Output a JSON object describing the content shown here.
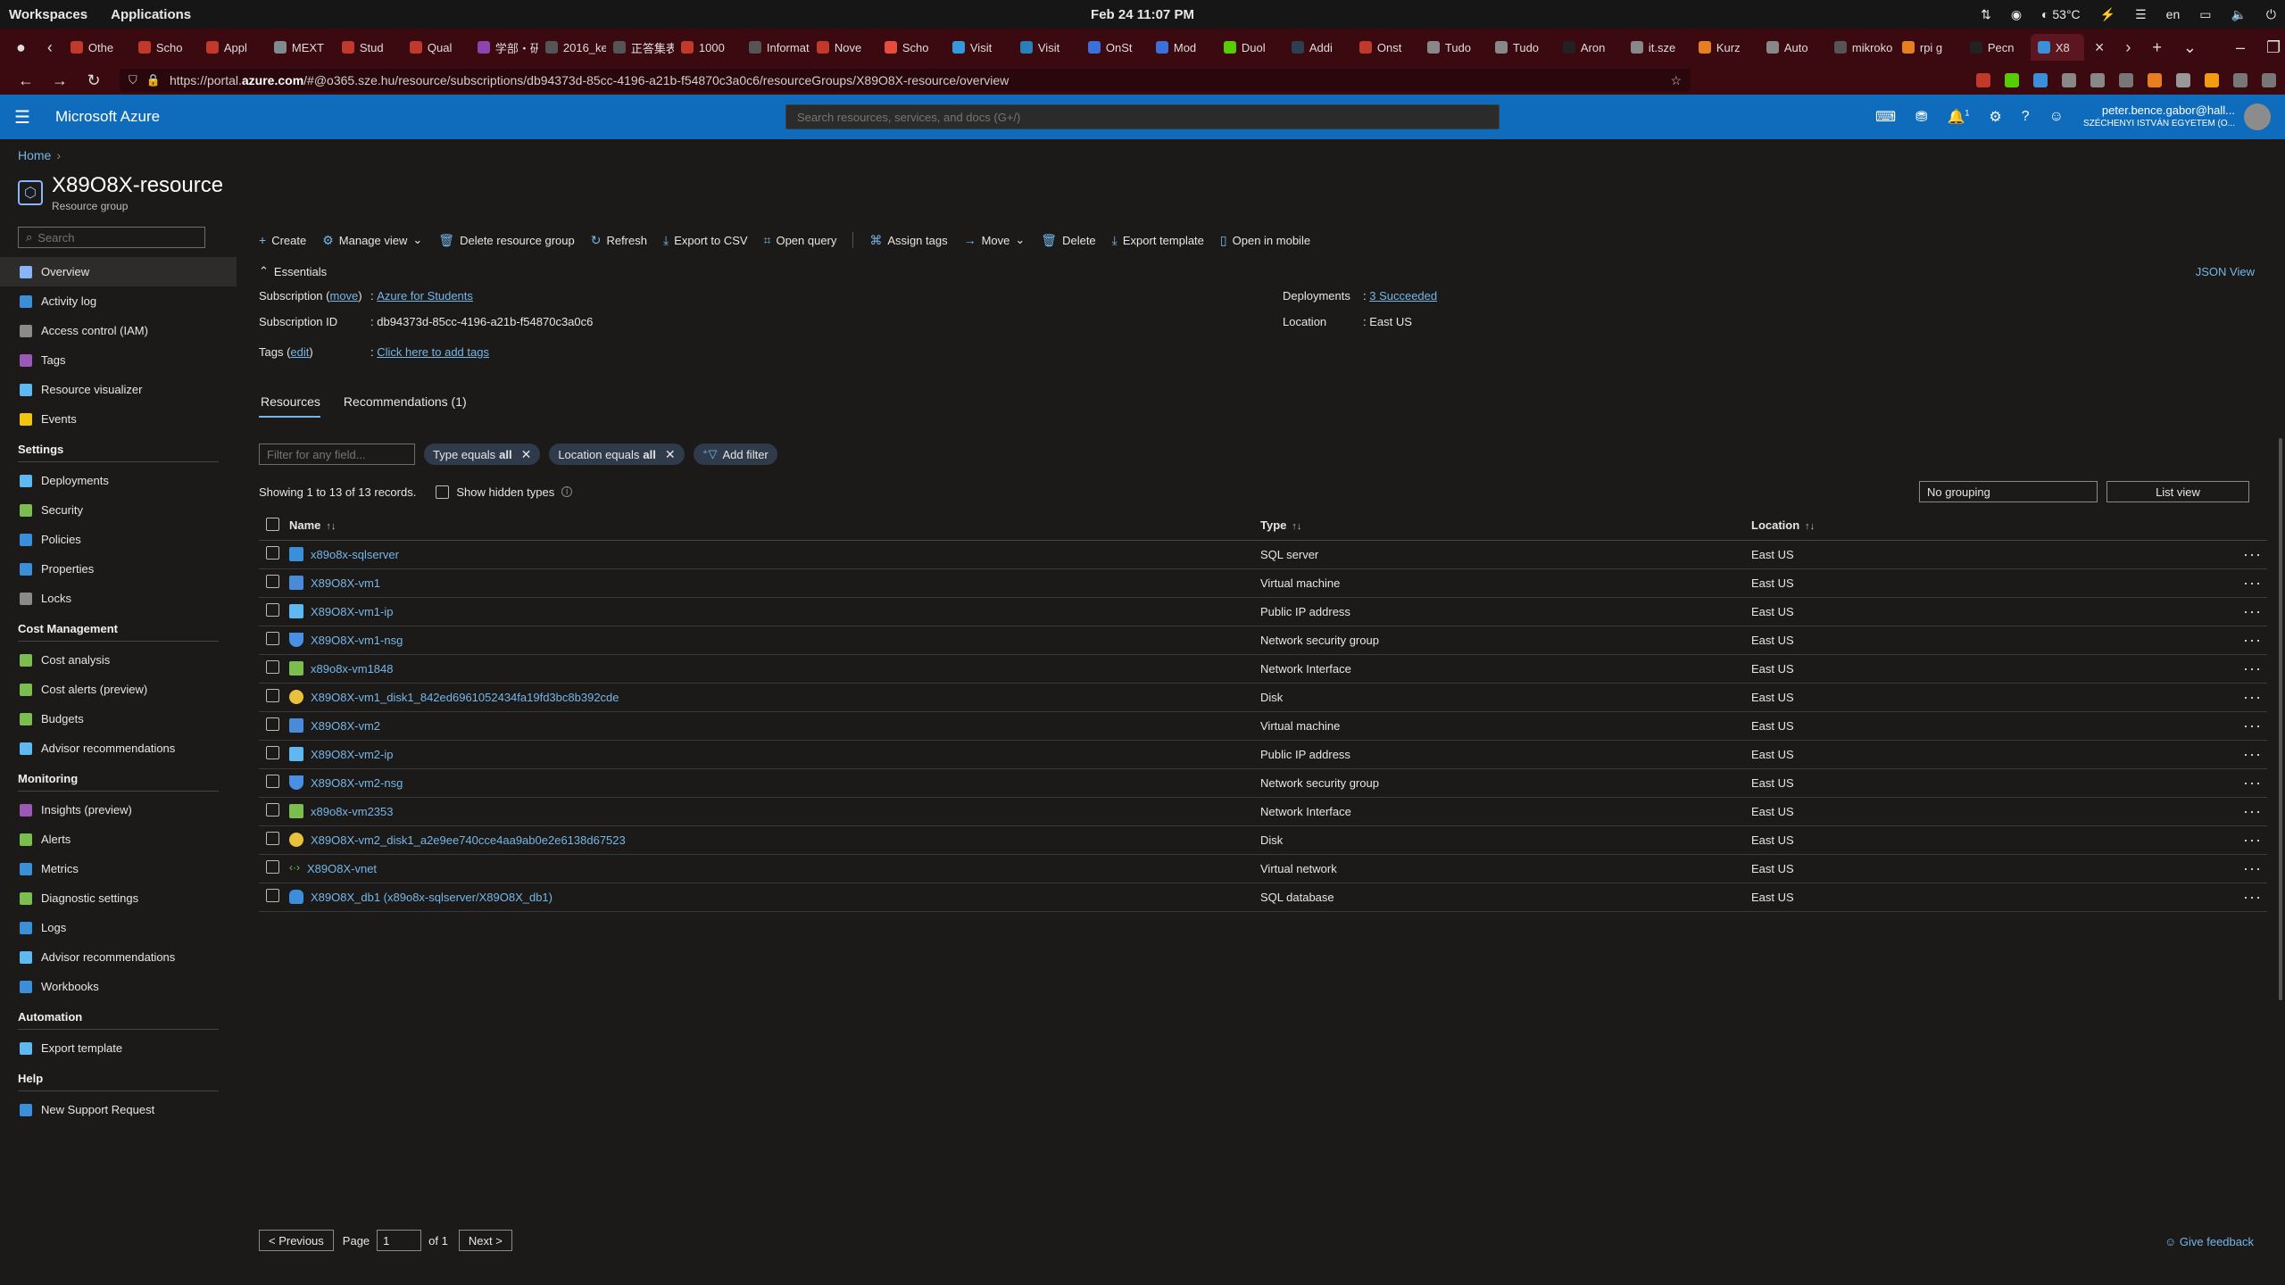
{
  "os": {
    "workspaces": "Workspaces",
    "applications": "Applications",
    "clock": "Feb 24  11:07 PM",
    "temp": "53°C",
    "lang": "en"
  },
  "browser": {
    "tabs": [
      {
        "label": "Othe",
        "color": "#c0392b"
      },
      {
        "label": "Scho",
        "color": "#c0392b"
      },
      {
        "label": "Appl",
        "color": "#c0392b"
      },
      {
        "label": "MEXT",
        "color": "#7f8c8d"
      },
      {
        "label": "Stud",
        "color": "#c0392b"
      },
      {
        "label": "Qual",
        "color": "#c0392b"
      },
      {
        "label": "学部・研",
        "color": "#8e44ad"
      },
      {
        "label": "2016_ke",
        "color": "#555555"
      },
      {
        "label": "正答集表",
        "color": "#555555"
      },
      {
        "label": "1000",
        "color": "#c0392b"
      },
      {
        "label": "Informat",
        "color": "#555555"
      },
      {
        "label": "Nove",
        "color": "#c0392b"
      },
      {
        "label": "Scho",
        "color": "#e74c3c"
      },
      {
        "label": "Visit",
        "color": "#3498db"
      },
      {
        "label": "Visit",
        "color": "#2980b9"
      },
      {
        "label": "OnSt",
        "color": "#3b6fd9"
      },
      {
        "label": "Mod",
        "color": "#3b6fd9"
      },
      {
        "label": "Duol",
        "color": "#58cc02"
      },
      {
        "label": "Addi",
        "color": "#2c3e50"
      },
      {
        "label": "Onst",
        "color": "#c0392b"
      },
      {
        "label": "Tudo",
        "color": "#888888"
      },
      {
        "label": "Tudo",
        "color": "#888888"
      },
      {
        "label": "Aron",
        "color": "#222222"
      },
      {
        "label": "it.sze",
        "color": "#888888"
      },
      {
        "label": "Kurz",
        "color": "#e67e22"
      },
      {
        "label": "Auto",
        "color": "#888888"
      },
      {
        "label": "mikroko",
        "color": "#555555"
      },
      {
        "label": "rpi g",
        "color": "#e67e22"
      },
      {
        "label": "Pecn",
        "color": "#222222"
      },
      {
        "label": "X8",
        "color": "#3b8fd9"
      }
    ],
    "url_prefix": "https://portal.",
    "url_host": "azure.com",
    "url_rest": "/#@o365.sze.hu/resource/subscriptions/db94373d-85cc-4196-a21b-f54870c3a0c6/resourceGroups/X89O8X-resource/overview"
  },
  "azure": {
    "brand": "Microsoft Azure",
    "search_placeholder": "Search resources, services, and docs (G+/)",
    "notif_count": "1",
    "user_email": "peter.bence.gabor@hall...",
    "user_org": "SZÉCHENYI ISTVÁN EGYETEM (O..."
  },
  "breadcrumb": {
    "home": "Home"
  },
  "header": {
    "title": "X89O8X-resource",
    "subtitle": "Resource group"
  },
  "sidebar": {
    "search_placeholder": "Search",
    "top_items": [
      {
        "label": "Overview",
        "color": "#8ab4f8"
      },
      {
        "label": "Activity log",
        "color": "#3b8fd9"
      },
      {
        "label": "Access control (IAM)",
        "color": "#8a8a8a"
      },
      {
        "label": "Tags",
        "color": "#9b59b6"
      },
      {
        "label": "Resource visualizer",
        "color": "#5fb9f0"
      },
      {
        "label": "Events",
        "color": "#f1c40f"
      }
    ],
    "sections": [
      {
        "title": "Settings",
        "items": [
          {
            "label": "Deployments",
            "color": "#5fb9f0"
          },
          {
            "label": "Security",
            "color": "#7bbd4f"
          },
          {
            "label": "Policies",
            "color": "#3b8fd9"
          },
          {
            "label": "Properties",
            "color": "#3b8fd9"
          },
          {
            "label": "Locks",
            "color": "#8a8a8a"
          }
        ]
      },
      {
        "title": "Cost Management",
        "items": [
          {
            "label": "Cost analysis",
            "color": "#7bbd4f"
          },
          {
            "label": "Cost alerts (preview)",
            "color": "#7bbd4f"
          },
          {
            "label": "Budgets",
            "color": "#7bbd4f"
          },
          {
            "label": "Advisor recommendations",
            "color": "#5fb9f0"
          }
        ]
      },
      {
        "title": "Monitoring",
        "items": [
          {
            "label": "Insights (preview)",
            "color": "#9b59b6"
          },
          {
            "label": "Alerts",
            "color": "#7bbd4f"
          },
          {
            "label": "Metrics",
            "color": "#3b8fd9"
          },
          {
            "label": "Diagnostic settings",
            "color": "#7bbd4f"
          },
          {
            "label": "Logs",
            "color": "#3b8fd9"
          },
          {
            "label": "Advisor recommendations",
            "color": "#5fb9f0"
          },
          {
            "label": "Workbooks",
            "color": "#3b8fd9"
          }
        ]
      },
      {
        "title": "Automation",
        "items": [
          {
            "label": "Export template",
            "color": "#5fb9f0"
          }
        ]
      },
      {
        "title": "Help",
        "items": [
          {
            "label": "New Support Request",
            "color": "#3b8fd9"
          }
        ]
      }
    ]
  },
  "toolbar": {
    "create": "Create",
    "manage_view": "Manage view",
    "delete_rg": "Delete resource group",
    "refresh": "Refresh",
    "export_csv": "Export to CSV",
    "open_query": "Open query",
    "assign_tags": "Assign tags",
    "move": "Move",
    "delete": "Delete",
    "export_template": "Export template",
    "open_mobile": "Open in mobile"
  },
  "essentials": {
    "heading": "Essentials",
    "json_view": "JSON View",
    "subscription_label": "Subscription",
    "move_link": "move",
    "subscription_value": "Azure for Students",
    "subscription_id_label": "Subscription ID",
    "subscription_id": "db94373d-85cc-4196-a21b-f54870c3a0c6",
    "tags_label": "Tags",
    "edit_link": "edit",
    "tags_value": "Click here to add tags",
    "deployments_label": "Deployments",
    "deployments_value": "3 Succeeded",
    "location_label": "Location",
    "location_value": "East US"
  },
  "tabs": {
    "resources": "Resources",
    "recommendations": "Recommendations (1)"
  },
  "filters": {
    "placeholder": "Filter for any field...",
    "type_label": "Type equals",
    "type_value": "all",
    "location_label": "Location equals",
    "location_value": "all",
    "add_filter": "Add filter"
  },
  "records": {
    "showing": "Showing 1 to 13 of 13 records.",
    "show_hidden": "Show hidden types",
    "grouping": "No grouping",
    "view": "List view"
  },
  "table": {
    "headers": {
      "name": "Name",
      "type": "Type",
      "location": "Location"
    },
    "rows": [
      {
        "name": "x89o8x-sqlserver",
        "type": "SQL server",
        "location": "East US",
        "icon": "sql"
      },
      {
        "name": "X89O8X-vm1",
        "type": "Virtual machine",
        "location": "East US",
        "icon": "vm"
      },
      {
        "name": "X89O8X-vm1-ip",
        "type": "Public IP address",
        "location": "East US",
        "icon": "ip"
      },
      {
        "name": "X89O8X-vm1-nsg",
        "type": "Network security group",
        "location": "East US",
        "icon": "nsg"
      },
      {
        "name": "x89o8x-vm1848",
        "type": "Network Interface",
        "location": "East US",
        "icon": "nic"
      },
      {
        "name": "X89O8X-vm1_disk1_842ed6961052434fa19fd3bc8b392cde",
        "type": "Disk",
        "location": "East US",
        "icon": "disk"
      },
      {
        "name": "X89O8X-vm2",
        "type": "Virtual machine",
        "location": "East US",
        "icon": "vm"
      },
      {
        "name": "X89O8X-vm2-ip",
        "type": "Public IP address",
        "location": "East US",
        "icon": "ip"
      },
      {
        "name": "X89O8X-vm2-nsg",
        "type": "Network security group",
        "location": "East US",
        "icon": "nsg"
      },
      {
        "name": "x89o8x-vm2353",
        "type": "Network Interface",
        "location": "East US",
        "icon": "nic"
      },
      {
        "name": "X89O8X-vm2_disk1_a2e9ee740cce4aa9ab0e2e6138d67523",
        "type": "Disk",
        "location": "East US",
        "icon": "disk"
      },
      {
        "name": "X89O8X-vnet",
        "type": "Virtual network",
        "location": "East US",
        "icon": "vnet"
      },
      {
        "name": "X89O8X_db1 (x89o8x-sqlserver/X89O8X_db1)",
        "type": "SQL database",
        "location": "East US",
        "icon": "db"
      }
    ]
  },
  "pager": {
    "previous": "< Previous",
    "page_label": "Page",
    "page_value": "1",
    "of": "of 1",
    "next": "Next >"
  },
  "feedback": "Give feedback"
}
